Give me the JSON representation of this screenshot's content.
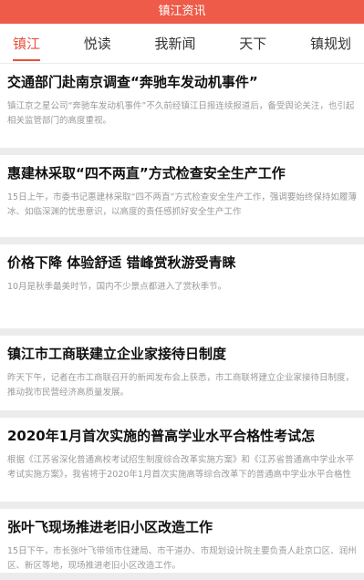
{
  "header": {
    "title": "镇江资讯"
  },
  "tabs": [
    {
      "label": "镇江",
      "active": true
    },
    {
      "label": "悦读",
      "active": false
    },
    {
      "label": "我新闻",
      "active": false
    },
    {
      "label": "天下",
      "active": false
    },
    {
      "label": "镇规划",
      "active": false
    }
  ],
  "articles": [
    {
      "title": "交通部门赴南京调查“奔驰车发动机事件”",
      "summary": "镇江京之星公司“奔驰车发动机事件”不久前经镇江日报连续报道后，备受舆论关注，也引起相关监管部门的高度重视。"
    },
    {
      "title": "惠建林采取“四不两直”方式检查安全生产工作",
      "summary": "15日上午，市委书记惠建林采取“四不两直”方式检查安全生产工作，强调要始终保持如履薄冰、如临深渊的忧患意识，以高度的责任感抓好安全生产工作"
    },
    {
      "title": "价格下降 体验舒适 错峰赏秋游受青睐",
      "summary": "10月是秋季最美时节，国内不少景点都进入了赏秋季节。"
    },
    {
      "title": "镇江市工商联建立企业家接待日制度",
      "summary": "昨天下午，记者在市工商联召开的新闻发布会上获悉，市工商联将建立企业家接待日制度，推动我市民营经济高质量发展。"
    },
    {
      "title": "2020年1月首次实施的普高学业水平合格性考试怎",
      "summary": "根据《江苏省深化普通高校考试招生制度综合改革实施方案》和《江苏省普通高中学业水平考试实施方案》，我省将于2020年1月首次实施高等综合改革下的普通高中学业水平合格性考试。"
    },
    {
      "title": "张叶飞现场推进老旧小区改造工作",
      "summary": "15日下午，市长张叶飞带领市住建局、市干道办、市规划设计院主要负责人赴京口区、润州区、新区等地，现场推进老旧小区改造工作。"
    }
  ]
}
